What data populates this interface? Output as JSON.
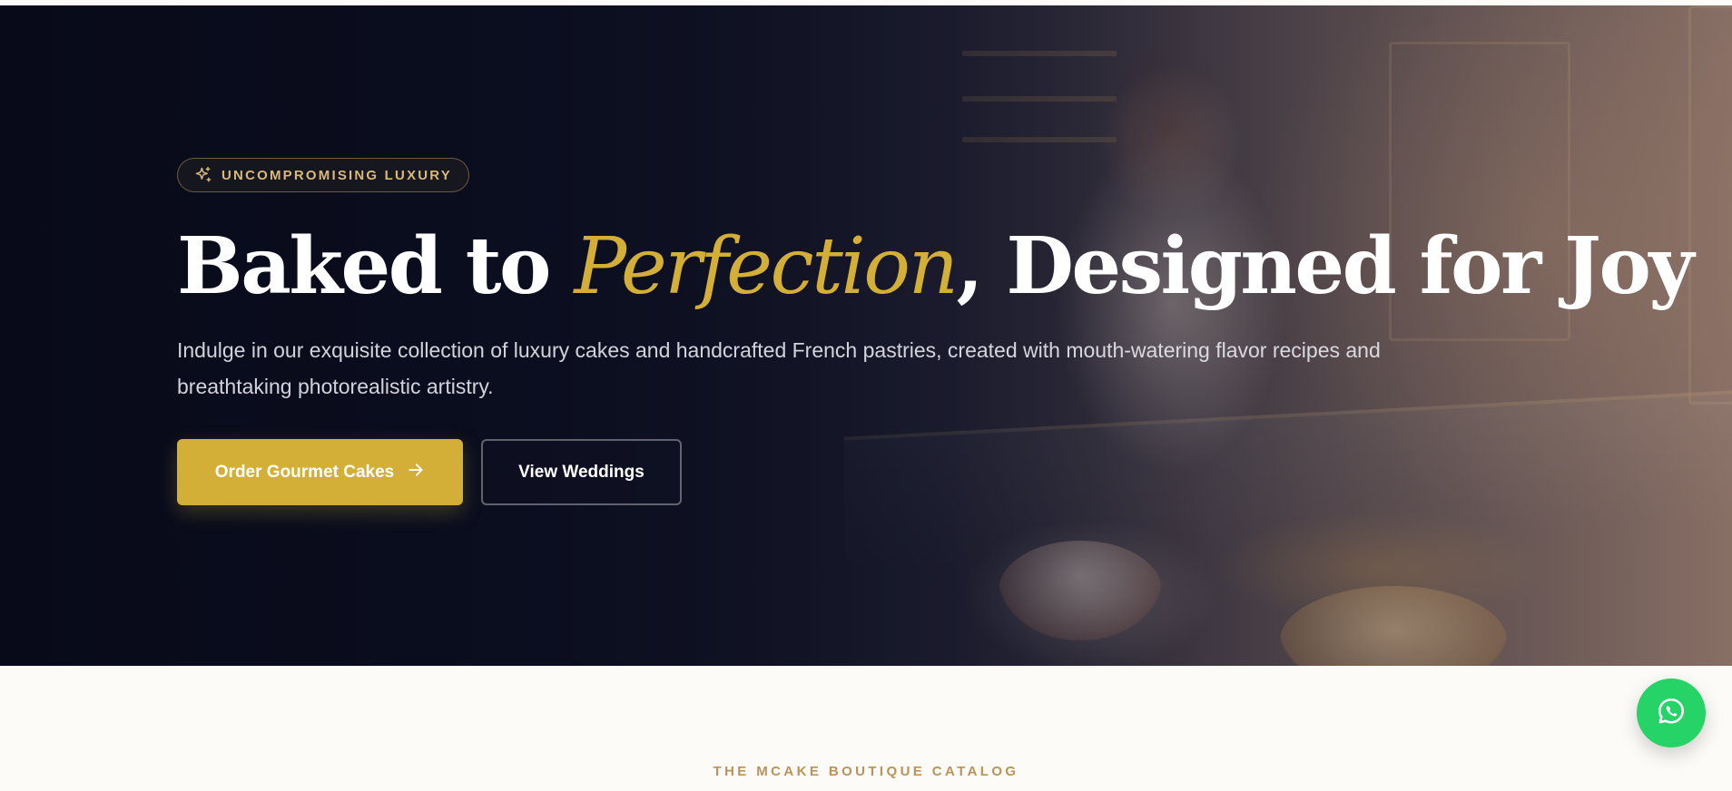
{
  "hero": {
    "badge_icon": "sparkles-icon",
    "badge": "UNCOMPROMISING LUXURY",
    "headline_part1": "Baked to ",
    "headline_accent": "Perfection",
    "headline_part2": ", Designed for Joy",
    "subtitle": "Indulge in our exquisite collection of luxury cakes and handcrafted French pastries, created with mouth-watering flavor recipes and breathtaking photorealistic artistry.",
    "primary_cta": "Order Gourmet Cakes",
    "primary_cta_icon": "arrow-right-icon",
    "secondary_cta": "View Weddings"
  },
  "catalog": {
    "eyebrow": "THE MCAKE BOUTIQUE CATALOG"
  },
  "fab": {
    "icon": "whatsapp-icon"
  },
  "colors": {
    "gold_accent": "#d4af37",
    "eyebrow_gold": "#b8935a",
    "hero_dark": "#0d1020",
    "whatsapp_green": "#25d366",
    "page_background": "#fdfbf7"
  }
}
